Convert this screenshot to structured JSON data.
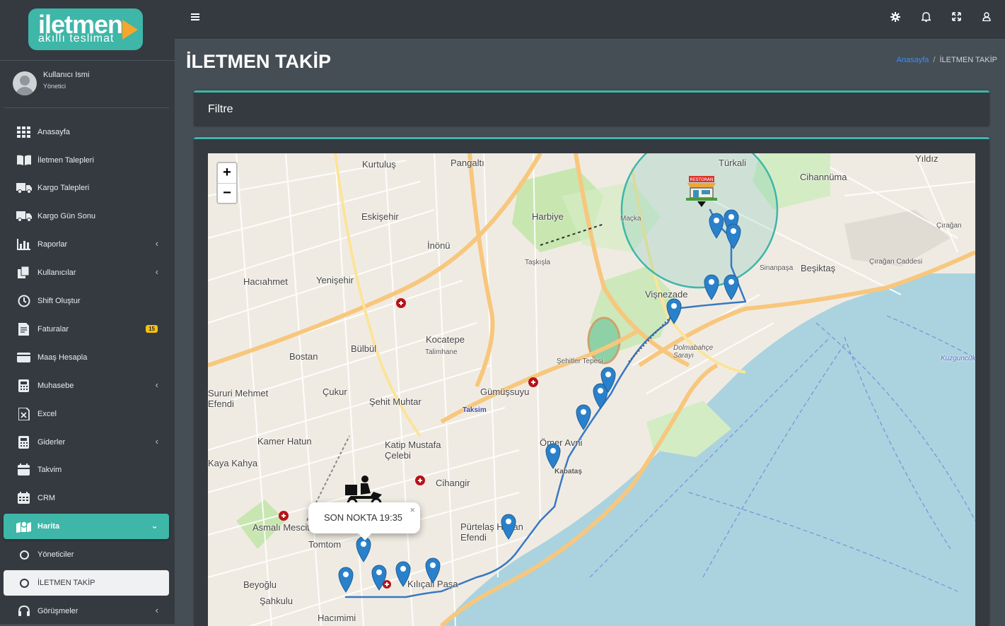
{
  "brand": {
    "title": "iletmen",
    "subtitle": "akıllı teslimat"
  },
  "user": {
    "name": "Kullanıcı Ismi",
    "role": "Yönetici"
  },
  "sidebar": {
    "items": [
      {
        "label": "Anasayfa",
        "icon": "grid-icon"
      },
      {
        "label": "İletmen Talepleri",
        "icon": "book-icon"
      },
      {
        "label": "Kargo Talepleri",
        "icon": "truck-icon"
      },
      {
        "label": "Kargo Gün Sonu",
        "icon": "truck-icon"
      },
      {
        "label": "Raporlar",
        "icon": "chart-icon",
        "has_submenu": true
      },
      {
        "label": "Kullanıcılar",
        "icon": "copy-icon",
        "has_submenu": true
      },
      {
        "label": "Shift Oluştur",
        "icon": "clock-icon"
      },
      {
        "label": "Faturalar",
        "icon": "invoice-icon",
        "badge": "15"
      },
      {
        "label": "Maaş Hesapla",
        "icon": "wallet-icon"
      },
      {
        "label": "Muhasebe",
        "icon": "calculator-icon",
        "has_submenu": true
      },
      {
        "label": "Excel",
        "icon": "excel-file-icon"
      },
      {
        "label": "Giderler",
        "icon": "calculator-icon",
        "has_submenu": true
      },
      {
        "label": "Takvim",
        "icon": "calendar-icon"
      },
      {
        "label": "CRM",
        "icon": "calendar-grid-icon"
      },
      {
        "label": "Harita",
        "icon": "map-icon",
        "active": true,
        "expanded": true
      },
      {
        "label": "Yöneticiler",
        "icon": "circle-icon"
      },
      {
        "label": "İLETMEN TAKİP",
        "icon": "circle-icon",
        "current": true
      },
      {
        "label": "Görüşmeler",
        "icon": "headset-icon",
        "has_submenu": true
      }
    ]
  },
  "topbar": {
    "menu_icon": "hamburger-icon",
    "icons": [
      "settings-icon",
      "bell-icon",
      "expand-icon",
      "user-icon"
    ]
  },
  "page": {
    "title": "İLETMEN TAKİP"
  },
  "breadcrumb": {
    "home": "Anasayfa",
    "current": "İLETMEN TAKİP"
  },
  "filter": {
    "title": "Filtre"
  },
  "map": {
    "zoom_in": "+",
    "zoom_out": "−",
    "popup_text": "SON NOKTA 19:35",
    "popup_close": "×",
    "labels": [
      "Kurtuluş",
      "Pangaltı",
      "Harbiye",
      "Türkali",
      "Cihannüma",
      "Yıldız",
      "Eskişehir",
      "Maçka",
      "Hacıahmet",
      "Yenişehir",
      "İnönü",
      "Beşiktaş",
      "Vişnezade",
      "Taşkışla",
      "Bostan",
      "Bülbül",
      "Kocatepe",
      "Talimhane",
      "Şehitler Tepesi",
      "Sururi Mehmet Efendi",
      "Çukur",
      "Şehit Muhtar",
      "Taksim",
      "Gümüşsuyu",
      "Kamer Hatun",
      "Katip Mustafa Çelebi",
      "Ömer Avni",
      "Kabataş",
      "Cihangir",
      "Asmalı Mescit",
      "Pürtelaş Hasan Efendi",
      "Tomtom",
      "Kılıçali Paşa",
      "Beyoğlu",
      "Şahkulu",
      "Hacımimi",
      "Kaya Kahya",
      "Çırağan",
      "Sinanpaşa",
      "Dolmabahçe Sarayı",
      "Çırağan Caddesi",
      "Kuzguncuk"
    ]
  }
}
